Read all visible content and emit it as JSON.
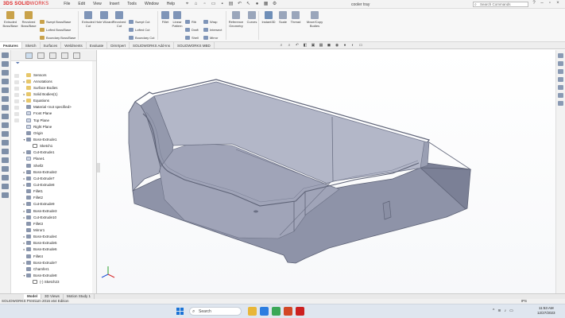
{
  "app": {
    "logo_prefix": "3DS",
    "logo_main": "SOLID",
    "logo_suffix": "WORKS",
    "document_title": "cooler tray",
    "search_placeholder": "Search Commands"
  },
  "menu": [
    "File",
    "Edit",
    "View",
    "Insert",
    "Tools",
    "Window",
    "Help"
  ],
  "ribbon": {
    "big": [
      {
        "label": "Extruded Boss/Base",
        "color": "#c9a24a"
      },
      {
        "label": "Revolved Boss/Base",
        "color": "#c9a24a"
      },
      {
        "label": "Extruded Cut",
        "color": "#7f95b8"
      },
      {
        "label": "Hole Wizard",
        "color": "#7f95b8"
      },
      {
        "label": "Revolved Cut",
        "color": "#7f95b8"
      },
      {
        "label": "Fillet",
        "color": "#7f95b8"
      },
      {
        "label": "Linear Pattern",
        "color": "#7f95b8"
      },
      {
        "label": "Reference Geometry",
        "color": "#9aa6bb"
      },
      {
        "label": "Curves",
        "color": "#9aa6bb"
      },
      {
        "label": "Instant3D",
        "color": "#6f8fb8"
      },
      {
        "label": "Scale",
        "color": "#9aa6bb"
      },
      {
        "label": "Thread",
        "color": "#9aa6bb"
      },
      {
        "label": "Move/Copy Bodies",
        "color": "#9aa6bb"
      }
    ],
    "small": [
      {
        "label": "Swept Boss/Base"
      },
      {
        "label": "Lofted Boss/Base"
      },
      {
        "label": "Boundary Boss/Base"
      },
      {
        "label": "Swept Cut"
      },
      {
        "label": "Lofted Cut"
      },
      {
        "label": "Boundary Cut"
      },
      {
        "label": "Rib"
      },
      {
        "label": "Draft"
      },
      {
        "label": "Shell"
      },
      {
        "label": "Wrap"
      },
      {
        "label": "Intersect"
      },
      {
        "label": "Mirror"
      }
    ]
  },
  "command_tabs": [
    "Features",
    "Sketch",
    "Surfaces",
    "Weldments",
    "Evaluate",
    "DimXpert",
    "SOLIDWORKS Add-Ins",
    "SOLIDWORKS MBD"
  ],
  "active_command_tab": "Features",
  "tree": {
    "filter_icon": "funnel-icon",
    "items": [
      {
        "label": "Sensors",
        "type": "folder",
        "expand": "",
        "indent": 0
      },
      {
        "label": "Annotations",
        "type": "folder",
        "expand": "▸",
        "indent": 0
      },
      {
        "label": "Surface Bodies",
        "type": "folder",
        "expand": "",
        "indent": 0
      },
      {
        "label": "Solid Bodies(1)",
        "type": "folder",
        "expand": "▸",
        "indent": 0
      },
      {
        "label": "Equations",
        "type": "folder",
        "expand": "▸",
        "indent": 0
      },
      {
        "label": "Material <not specified>",
        "type": "feature",
        "expand": "",
        "indent": 0
      },
      {
        "label": "Front Plane",
        "type": "plane",
        "expand": "",
        "indent": 0
      },
      {
        "label": "Top Plane",
        "type": "plane",
        "expand": "",
        "indent": 0
      },
      {
        "label": "Right Plane",
        "type": "plane",
        "expand": "",
        "indent": 0
      },
      {
        "label": "Origin",
        "type": "feature",
        "expand": "",
        "indent": 0
      },
      {
        "label": "Boss-Extrude1",
        "type": "feature",
        "expand": "▾",
        "indent": 0
      },
      {
        "label": "Sketch1",
        "type": "sketch",
        "expand": "",
        "indent": 2
      },
      {
        "label": "Cut-Extrude1",
        "type": "feature",
        "expand": "▸",
        "indent": 0
      },
      {
        "label": "Plane1",
        "type": "plane",
        "expand": "",
        "indent": 0
      },
      {
        "label": "Shell2",
        "type": "feature",
        "expand": "",
        "indent": 0
      },
      {
        "label": "Boss-Extrude2",
        "type": "feature",
        "expand": "▸",
        "indent": 0
      },
      {
        "label": "Cut-Extrude7",
        "type": "feature",
        "expand": "▸",
        "indent": 0
      },
      {
        "label": "Cut-Extrude8",
        "type": "feature",
        "expand": "▸",
        "indent": 0
      },
      {
        "label": "Fillet1",
        "type": "feature",
        "expand": "",
        "indent": 0
      },
      {
        "label": "Fillet2",
        "type": "feature",
        "expand": "",
        "indent": 0
      },
      {
        "label": "Cut-Extrude9",
        "type": "feature",
        "expand": "▸",
        "indent": 0
      },
      {
        "label": "Boss-Extrude3",
        "type": "feature",
        "expand": "▸",
        "indent": 0
      },
      {
        "label": "Cut-Extrude10",
        "type": "feature",
        "expand": "▸",
        "indent": 0
      },
      {
        "label": "Fillet3",
        "type": "feature",
        "expand": "",
        "indent": 0
      },
      {
        "label": "Mirror1",
        "type": "feature",
        "expand": "",
        "indent": 0
      },
      {
        "label": "Boss-Extrude4",
        "type": "feature",
        "expand": "▸",
        "indent": 0
      },
      {
        "label": "Boss-Extrude5",
        "type": "feature",
        "expand": "▸",
        "indent": 0
      },
      {
        "label": "Boss-Extrude6",
        "type": "feature",
        "expand": "▸",
        "indent": 0
      },
      {
        "label": "Fillet4",
        "type": "feature",
        "expand": "",
        "indent": 0
      },
      {
        "label": "Boss-Extrude7",
        "type": "feature",
        "expand": "▸",
        "indent": 0
      },
      {
        "label": "Chamfer1",
        "type": "feature",
        "expand": "",
        "indent": 0
      },
      {
        "label": "Boss-Extrude8",
        "type": "feature",
        "expand": "▾",
        "indent": 0
      },
      {
        "label": "(-) Sketch23",
        "type": "sketch",
        "expand": "",
        "indent": 2
      }
    ]
  },
  "model_tabs": [
    "Model",
    "3D Views",
    "Motion Study 1"
  ],
  "active_model_tab": "Model",
  "status": {
    "text": "SOLIDWORKS Premium 2016 x64 Edition",
    "units": "IPS"
  },
  "taskbar": {
    "search_label": "Search",
    "time": "11:53 AM",
    "date": "12/27/2023",
    "apps": [
      {
        "name": "file-explorer-icon",
        "color": "#e8b638"
      },
      {
        "name": "browser-icon",
        "color": "#2b7de0"
      },
      {
        "name": "chrome-icon",
        "color": "#3aa757"
      },
      {
        "name": "mail-icon",
        "color": "#d24726"
      },
      {
        "name": "solidworks-icon",
        "color": "#cc2020"
      }
    ]
  },
  "colors": {
    "accent": "#d22020",
    "model_fill": "#8e93a8",
    "model_dark": "#5e6377",
    "model_light": "#b2b6c8"
  }
}
